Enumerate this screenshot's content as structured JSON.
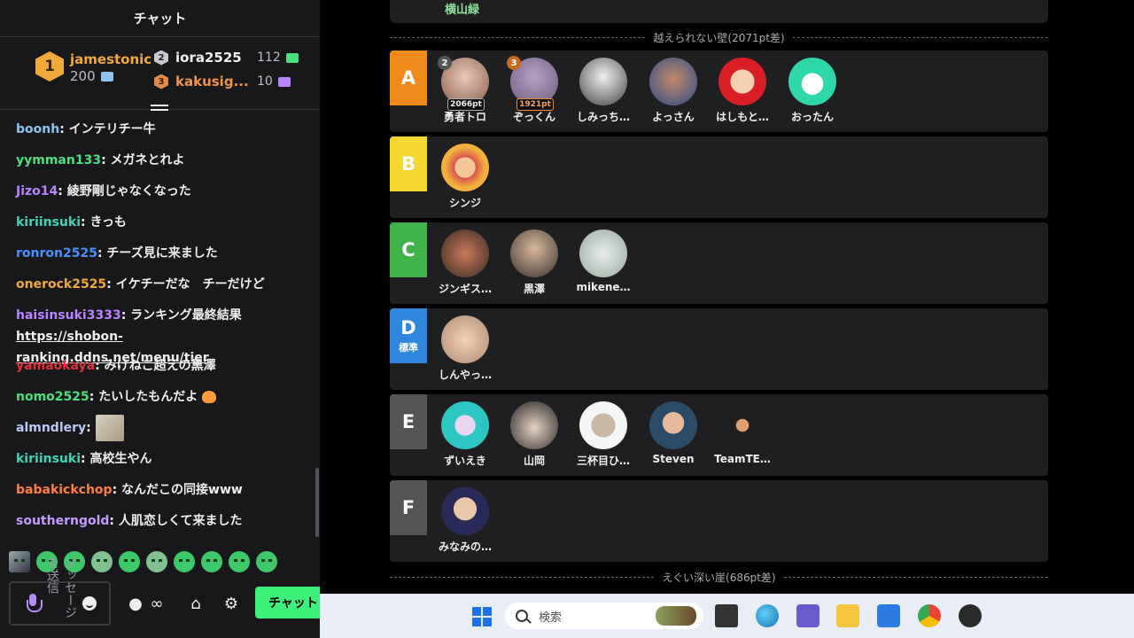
{
  "chat": {
    "title": "チャット",
    "leaderboard": {
      "first": {
        "rank": "1",
        "name": "jamestonic",
        "points": "200"
      },
      "second": {
        "rank": "2",
        "name": "iora2525",
        "points": "112"
      },
      "third": {
        "rank": "3",
        "name": "kakusig...",
        "points": "10"
      }
    },
    "messages": [
      {
        "user": "boonh",
        "text": ": インテリチー牛",
        "color": "#8ec4f2"
      },
      {
        "user": "yymman133",
        "text": ": メガネとれよ",
        "color": "#4ae07c"
      },
      {
        "user": "Jizo14",
        "text": ": 綾野剛じゃなくなった",
        "color": "#b884ff"
      },
      {
        "user": "kiriinsuki",
        "text": ": きっも",
        "color": "#3dd6b4"
      },
      {
        "user": "ronron2525",
        "text": ": チーズ見に来ました",
        "color": "#4a90ff"
      },
      {
        "user": "onerock2525",
        "text": ": イケチーだな　チーだけど",
        "color": "#f0a93a"
      },
      {
        "user": "haisinsuki3333",
        "text": ": ランキング最終結果",
        "link": "https://shobon-ranking.ddns.net/menu/tier",
        "color": "#b884ff"
      },
      {
        "user": "yamaokaya",
        "text": ": みけねこ超えの黒澤",
        "color": "#e0303a"
      },
      {
        "user": "nomo2525",
        "text": ": たいしたもんだよ",
        "color": "#4ae07c"
      },
      {
        "user": "almndlery",
        "text": ": ",
        "color": "#b9c8f5"
      },
      {
        "user": "kiriinsuki",
        "text": ": 高校生やん",
        "color": "#3dd6b4"
      },
      {
        "user": "babakickchop",
        "text": ": なんだこの同接www",
        "color": "#ff7f3a"
      },
      {
        "user": "southerngold",
        "text": ": 人肌恋しくて来ました",
        "color": "#c39bff"
      }
    ],
    "input_placeholder": "メッセージを送信",
    "chat_button": "チャット",
    "infinity": "∞"
  },
  "tiers": {
    "top_card_name": "横山緑",
    "divider_top": "越えられない壁(2071pt差)",
    "divider_bottom": "えぐい深い崖(686pt差)",
    "rows": [
      {
        "tag": "A",
        "sub": "",
        "color": "#f08a1a",
        "members": [
          "勇者トロ",
          "ぞっくん",
          "しみっち…",
          "よっさん",
          "はしもと…",
          "おったん"
        ]
      },
      {
        "tag": "B",
        "sub": "",
        "color": "#f5d731",
        "members": [
          "シンジ"
        ]
      },
      {
        "tag": "C",
        "sub": "",
        "color": "#3fb34a",
        "members": [
          "ジンギス…",
          "黒澤",
          "mikene…"
        ]
      },
      {
        "tag": "D",
        "sub": "標準",
        "color": "#2e86de",
        "members": [
          "しんやっ…"
        ]
      },
      {
        "tag": "E",
        "sub": "",
        "color": "#555555",
        "members": [
          "ずいえき",
          "山岡",
          "三杯目ひ…",
          "Steven",
          "TeamTE…"
        ]
      },
      {
        "tag": "F",
        "sub": "",
        "color": "#555555",
        "members": [
          "みなみの…"
        ]
      }
    ],
    "a_badges": {
      "first": {
        "rank": "2",
        "pts": "2066pt"
      },
      "second": {
        "rank": "3",
        "pts": "1921pt"
      }
    }
  },
  "taskbar": {
    "search_placeholder": "検索"
  }
}
